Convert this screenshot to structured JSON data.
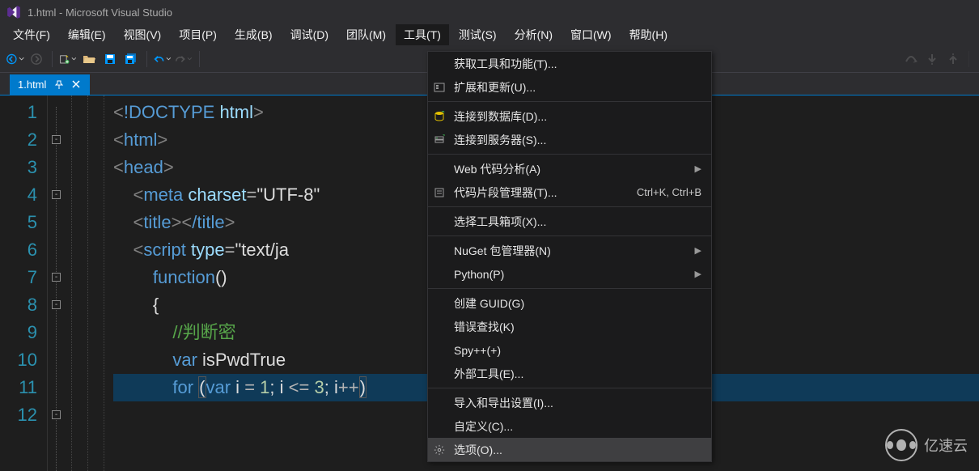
{
  "title": "1.html - Microsoft Visual Studio",
  "menubar": {
    "items": [
      "文件(F)",
      "编辑(E)",
      "视图(V)",
      "项目(P)",
      "生成(B)",
      "调试(D)",
      "团队(M)",
      "工具(T)",
      "测试(S)",
      "分析(N)",
      "窗口(W)",
      "帮助(H)"
    ],
    "active_index": 7
  },
  "tab": {
    "label": "1.html"
  },
  "toolbar": {
    "back": "◄",
    "forward": "►",
    "new": "new",
    "open": "open",
    "save": "save",
    "saveall": "saveall",
    "undo": "undo",
    "redo": "redo"
  },
  "dropdown": {
    "items": [
      {
        "icon": "",
        "label": "获取工具和功能(T)...",
        "shortcut": "",
        "arrow": false
      },
      {
        "icon": "ext",
        "label": "扩展和更新(U)...",
        "shortcut": "",
        "arrow": false
      },
      {
        "divider": true
      },
      {
        "icon": "db",
        "label": "连接到数据库(D)...",
        "shortcut": "",
        "arrow": false
      },
      {
        "icon": "srv",
        "label": "连接到服务器(S)...",
        "shortcut": "",
        "arrow": false
      },
      {
        "divider": true
      },
      {
        "icon": "",
        "label": "Web 代码分析(A)",
        "shortcut": "",
        "arrow": true
      },
      {
        "icon": "snip",
        "label": "代码片段管理器(T)...",
        "shortcut": "Ctrl+K, Ctrl+B",
        "arrow": false
      },
      {
        "divider": true
      },
      {
        "icon": "",
        "label": "选择工具箱项(X)...",
        "shortcut": "",
        "arrow": false
      },
      {
        "divider": true
      },
      {
        "icon": "",
        "label": "NuGet 包管理器(N)",
        "shortcut": "",
        "arrow": true
      },
      {
        "icon": "",
        "label": "Python(P)",
        "shortcut": "",
        "arrow": true
      },
      {
        "divider": true
      },
      {
        "icon": "",
        "label": "创建 GUID(G)",
        "shortcut": "",
        "arrow": false
      },
      {
        "icon": "",
        "label": "错误查找(K)",
        "shortcut": "",
        "arrow": false
      },
      {
        "icon": "",
        "label": "Spy++(+)",
        "shortcut": "",
        "arrow": false
      },
      {
        "icon": "",
        "label": "外部工具(E)...",
        "shortcut": "",
        "arrow": false
      },
      {
        "divider": true
      },
      {
        "icon": "",
        "label": "导入和导出设置(I)...",
        "shortcut": "",
        "arrow": false
      },
      {
        "icon": "",
        "label": "自定义(C)...",
        "shortcut": "",
        "arrow": false
      },
      {
        "icon": "gear",
        "label": "选项(O)...",
        "shortcut": "",
        "arrow": false,
        "hover": true
      }
    ]
  },
  "code": {
    "lines": [
      [
        {
          "t": "<",
          "c": "tk-bracket"
        },
        {
          "t": "!DOCTYPE ",
          "c": "tk-tag"
        },
        {
          "t": "html",
          "c": "tk-attr"
        },
        {
          "t": ">",
          "c": "tk-bracket"
        }
      ],
      [
        {
          "t": "<",
          "c": "tk-bracket"
        },
        {
          "t": "html",
          "c": "tk-tag"
        },
        {
          "t": ">",
          "c": "tk-bracket"
        }
      ],
      [
        {
          "t": "",
          "c": ""
        }
      ],
      [
        {
          "t": "<",
          "c": "tk-bracket"
        },
        {
          "t": "head",
          "c": "tk-tag"
        },
        {
          "t": ">",
          "c": "tk-bracket"
        }
      ],
      [
        {
          "t": "    ",
          "c": ""
        },
        {
          "t": "<",
          "c": "tk-bracket"
        },
        {
          "t": "meta ",
          "c": "tk-tag"
        },
        {
          "t": "charset",
          "c": "tk-attr"
        },
        {
          "t": "=",
          "c": "tk-op"
        },
        {
          "t": "\"UTF-8\"",
          "c": "tk-str"
        }
      ],
      [
        {
          "t": "    ",
          "c": ""
        },
        {
          "t": "<",
          "c": "tk-bracket"
        },
        {
          "t": "title",
          "c": "tk-tag"
        },
        {
          "t": ">",
          "c": "tk-bracket"
        },
        {
          "t": "<",
          "c": "tk-bracket"
        },
        {
          "t": "/title",
          "c": "tk-tag"
        },
        {
          "t": ">",
          "c": "tk-bracket"
        }
      ],
      [
        {
          "t": "    ",
          "c": ""
        },
        {
          "t": "<",
          "c": "tk-bracket"
        },
        {
          "t": "script ",
          "c": "tk-tag"
        },
        {
          "t": "type",
          "c": "tk-attr"
        },
        {
          "t": "=",
          "c": "tk-op"
        },
        {
          "t": "\"text/ja",
          "c": "tk-str"
        }
      ],
      [
        {
          "t": "        ",
          "c": ""
        },
        {
          "t": "function",
          "c": "tk-kw"
        },
        {
          "t": "()",
          "c": "tk-id"
        }
      ],
      [
        {
          "t": "        ",
          "c": ""
        },
        {
          "t": "{",
          "c": "tk-id"
        }
      ],
      [
        {
          "t": "            ",
          "c": ""
        },
        {
          "t": "//判断密",
          "c": "tk-comment"
        }
      ],
      [
        {
          "t": "            ",
          "c": ""
        },
        {
          "t": "var",
          "c": "tk-kw"
        },
        {
          "t": " isPwdTrue",
          "c": "tk-id"
        }
      ],
      [
        {
          "t": "            ",
          "c": ""
        },
        {
          "t": "for",
          "c": "tk-kw"
        },
        {
          "t": " ",
          "c": ""
        },
        {
          "t": "(",
          "c": "paren"
        },
        {
          "t": "var",
          "c": "tk-kw"
        },
        {
          "t": " i ",
          "c": "tk-id"
        },
        {
          "t": "=",
          "c": "tk-op"
        },
        {
          "t": " ",
          "c": ""
        },
        {
          "t": "1",
          "c": "tk-num"
        },
        {
          "t": "; i ",
          "c": "tk-id"
        },
        {
          "t": "<=",
          "c": "tk-op"
        },
        {
          "t": " ",
          "c": ""
        },
        {
          "t": "3",
          "c": "tk-num"
        },
        {
          "t": "; i",
          "c": "tk-id"
        },
        {
          "t": "++",
          "c": "tk-op"
        },
        {
          "t": ")",
          "c": "paren"
        }
      ]
    ],
    "line_numbers": [
      "1",
      "2",
      "3",
      "4",
      "5",
      "6",
      "7",
      "8",
      "9",
      "10",
      "11",
      "12"
    ],
    "fold_boxes": [
      2,
      4,
      7,
      8,
      12
    ],
    "highlight_line": 12
  },
  "watermark": "亿速云"
}
